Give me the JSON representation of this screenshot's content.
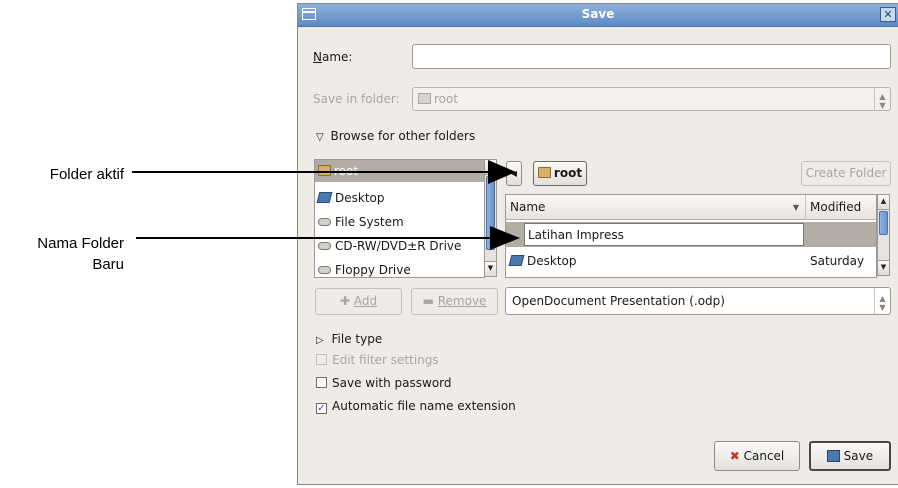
{
  "annotations": {
    "folder_aktif": "Folder aktif",
    "nama_folder_line1": "Nama Folder",
    "nama_folder_line2": "Baru"
  },
  "dialog": {
    "title": "Save",
    "name_label": "Name:",
    "name_value": "",
    "save_in_label": "Save in folder:",
    "save_in_value": "root",
    "browse_label": "Browse for other folders",
    "places": [
      {
        "label": "root",
        "icon": "home-folder-icon",
        "selected": true
      },
      {
        "label": "Desktop",
        "icon": "desktop-icon"
      },
      {
        "label": "File System",
        "icon": "drive-icon"
      },
      {
        "label": "CD-RW/DVD±R Drive",
        "icon": "optical-drive-icon"
      },
      {
        "label": "Floppy Drive",
        "icon": "floppy-drive-icon"
      }
    ],
    "path_button": "root",
    "create_folder": "Create Folder",
    "columns": {
      "name": "Name",
      "modified": "Modified"
    },
    "new_folder_value": "Latihan Impress",
    "files": [
      {
        "name": "Desktop",
        "modified": "Saturday",
        "icon": "desktop-icon"
      }
    ],
    "add_button": "Add",
    "remove_button": "Remove",
    "filter_value": "OpenDocument Presentation (.odp)",
    "file_type_label": "File type",
    "edit_filter_label": "Edit filter settings",
    "save_password_label": "Save with password",
    "auto_ext_label": "Automatic file name extension",
    "auto_ext_checked": true,
    "cancel_button": "Cancel",
    "save_button": "Save"
  },
  "colors": {
    "titlebar": "#6f98cf",
    "selection": "#b2aca5",
    "dialog_bg": "#efebe7"
  }
}
